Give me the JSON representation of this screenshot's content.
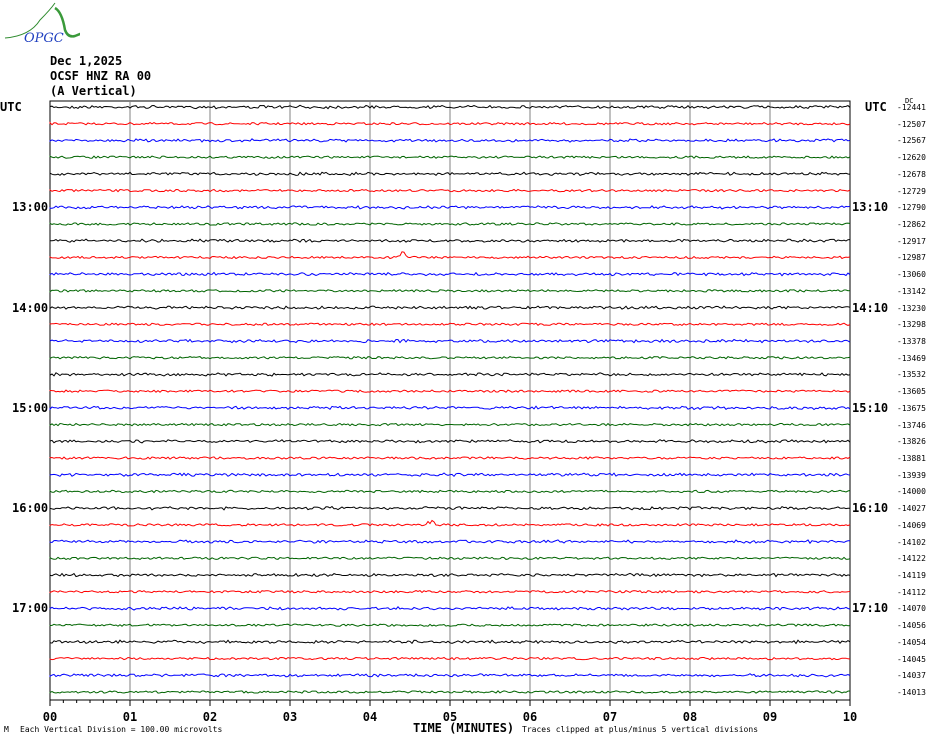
{
  "header": {
    "date": "Dec 1,2025",
    "station": "OCSF HNZ RA 00",
    "component": "(A Vertical)"
  },
  "logo_text": "OPGC",
  "colors": {
    "trace_cycle": [
      "#000000",
      "#ff0000",
      "#0000ff",
      "#006400"
    ],
    "grid": "#808080"
  },
  "chart_data": {
    "type": "line",
    "title": "Dec 1,2025 OCSF HNZ RA 00 (A Vertical)",
    "xlabel": "TIME (MINUTES)",
    "x_ticks": [
      "00",
      "01",
      "02",
      "03",
      "04",
      "05",
      "06",
      "07",
      "08",
      "09",
      "10"
    ],
    "xlim": [
      0,
      10
    ],
    "left_axis_title": "UTC",
    "right_axis_title": "UTC",
    "dc_title": "DC",
    "left_labels": [
      {
        "row": 6,
        "text": "13:00"
      },
      {
        "row": 12,
        "text": "14:00"
      },
      {
        "row": 18,
        "text": "15:00"
      },
      {
        "row": 24,
        "text": "16:00"
      },
      {
        "row": 30,
        "text": "17:00"
      }
    ],
    "right_labels": [
      {
        "row": 6,
        "text": "13:10"
      },
      {
        "row": 12,
        "text": "14:10"
      },
      {
        "row": 18,
        "text": "15:10"
      },
      {
        "row": 24,
        "text": "16:10"
      },
      {
        "row": 30,
        "text": "17:10"
      }
    ],
    "dc_offsets": [
      "-12441",
      "-12507",
      "-12567",
      "-12620",
      "-12678",
      "-12729",
      "-12790",
      "-12862",
      "-12917",
      "-12987",
      "-13060",
      "-13142",
      "-13230",
      "-13298",
      "-13378",
      "-13469",
      "-13532",
      "-13605",
      "-13675",
      "-13746",
      "-13826",
      "-13881",
      "-13939",
      "-14000",
      "-14027",
      "-14069",
      "-14102",
      "-14122",
      "-14119",
      "-14112",
      "-14070",
      "-14056",
      "-14054",
      "-14045",
      "-14037",
      "-14013"
    ],
    "events": [
      {
        "row": 9,
        "minute": 4.4
      },
      {
        "row": 25,
        "minute": 4.75
      }
    ],
    "grid": true
  },
  "footer": {
    "corner": "M",
    "scale": "Each Vertical Division =  100.00 microvolts",
    "axis_title": "TIME (MINUTES)",
    "clip": "Traces clipped at plus/minus 5 vertical divisions"
  }
}
